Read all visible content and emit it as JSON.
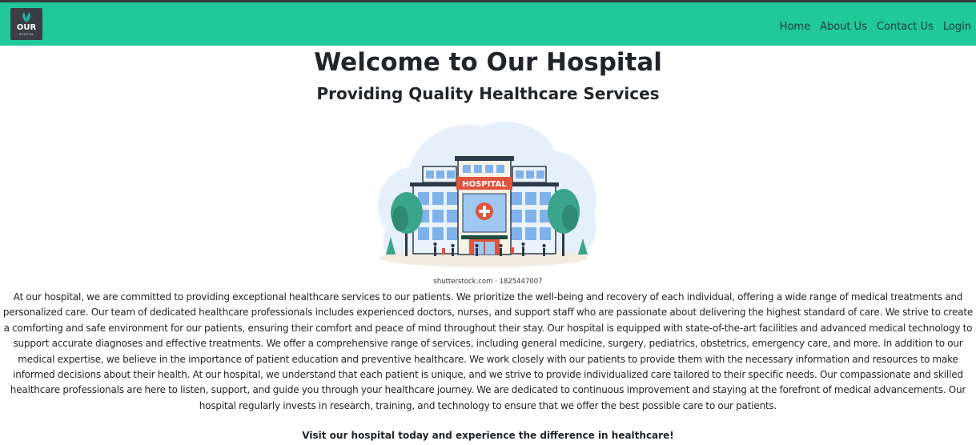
{
  "navbar": {
    "logo": {
      "word": "OUR",
      "sub": "HOSPITAL",
      "icon": "leaf-icon"
    },
    "links": [
      "Home",
      "About Us",
      "Contact Us",
      "Login"
    ]
  },
  "main": {
    "title": "Welcome to Our Hospital",
    "subtitle": "Providing Quality Healthcare Services",
    "image": {
      "sign": "HOSPITAL",
      "caption": "shutterstock.com · 1825447007"
    },
    "body": "At our hospital, we are committed to providing exceptional healthcare services to our patients. We prioritize the well-being and recovery of each individual, offering a wide range of medical treatments and personalized care. Our team of dedicated healthcare professionals includes experienced doctors, nurses, and support staff who are passionate about delivering the highest standard of care. We strive to create a comforting and safe environment for our patients, ensuring their comfort and peace of mind throughout their stay. Our hospital is equipped with state-of-the-art facilities and advanced medical technology to support accurate diagnoses and effective treatments. We offer a comprehensive range of services, including general medicine, surgery, pediatrics, obstetrics, emergency care, and more. In addition to our medical expertise, we believe in the importance of patient education and preventive healthcare. We work closely with our patients to provide them with the necessary information and resources to make informed decisions about their health. At our hospital, we understand that each patient is unique, and we strive to provide individualized care tailored to their specific needs. Our compassionate and skilled healthcare professionals are here to listen, support, and guide you through your healthcare journey. We are dedicated to continuous improvement and staying at the forefront of medical advancements. Our hospital regularly invests in research, training, and technology to ensure that we offer the best possible care to our patients.",
    "closing": "Visit our hospital today and experience the difference in healthcare!"
  },
  "colors": {
    "navbar": "#20c997",
    "text": "#212529",
    "hospital_sign": "#e0533c"
  }
}
